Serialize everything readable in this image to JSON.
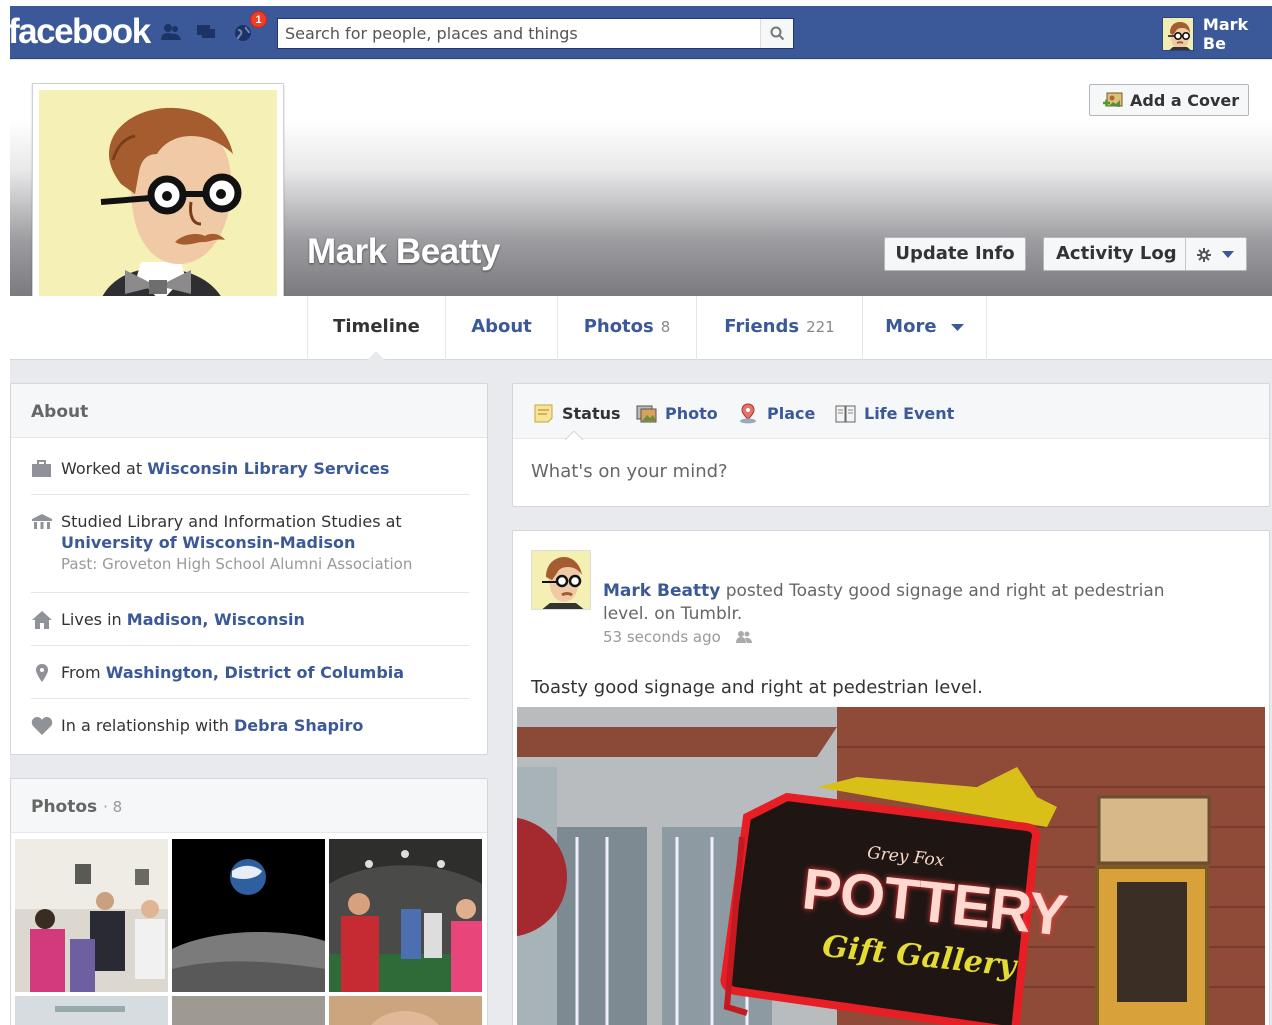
{
  "topbar": {
    "logo": "facebook",
    "notification_count": "1",
    "search_placeholder": "Search for people, places and things",
    "user_name": "Mark Be"
  },
  "profile": {
    "name": "Mark Beatty",
    "add_cover_label": "Add a Cover",
    "update_info_label": "Update Info",
    "activity_log_label": "Activity Log"
  },
  "tabs": [
    {
      "label": "Timeline",
      "count": ""
    },
    {
      "label": "About",
      "count": ""
    },
    {
      "label": "Photos",
      "count": "8"
    },
    {
      "label": "Friends",
      "count": "221"
    },
    {
      "label": "More",
      "count": ""
    }
  ],
  "about": {
    "title": "About",
    "work_prefix": "Worked at ",
    "work_place": "Wisconsin Library Services",
    "study_prefix": "Studied Library and Information Studies at ",
    "study_school": "University of Wisconsin-Madison",
    "study_past": "Past: Groveton High School Alumni Association",
    "lives_prefix": "Lives in ",
    "lives_place": "Madison, Wisconsin",
    "from_prefix": "From ",
    "from_place": "Washington, District of Columbia",
    "rel_prefix": "In a relationship with ",
    "rel_person": "Debra Shapiro"
  },
  "photos_panel": {
    "title": "Photos",
    "count": "· 8"
  },
  "composer": {
    "tabs": [
      "Status",
      "Photo",
      "Place",
      "Life Event"
    ],
    "placeholder": "What's on your mind?"
  },
  "post": {
    "author": "Mark Beatty",
    "action": " posted Toasty good signage and right at pedestrian level. on Tumblr.",
    "time": "53 seconds ago",
    "text": "Toasty good signage and right at pedestrian level.",
    "sign_top": "Grey Fox",
    "sign_main": "POTTERY",
    "sign_sub": "Gift Gallery"
  },
  "colors": {
    "brand_blue": "#3b5998",
    "page_bg": "#e9eaed",
    "badge_red": "#f03d25"
  },
  "icons": [
    "friends-icon",
    "messages-icon",
    "globe-icon",
    "search-icon",
    "add-cover-icon",
    "gear-icon",
    "work-icon",
    "school-icon",
    "home-icon",
    "location-pin-icon",
    "heart-icon",
    "status-icon",
    "photo-icon",
    "place-icon",
    "life-event-icon",
    "audience-icon",
    "caret-down-icon"
  ]
}
